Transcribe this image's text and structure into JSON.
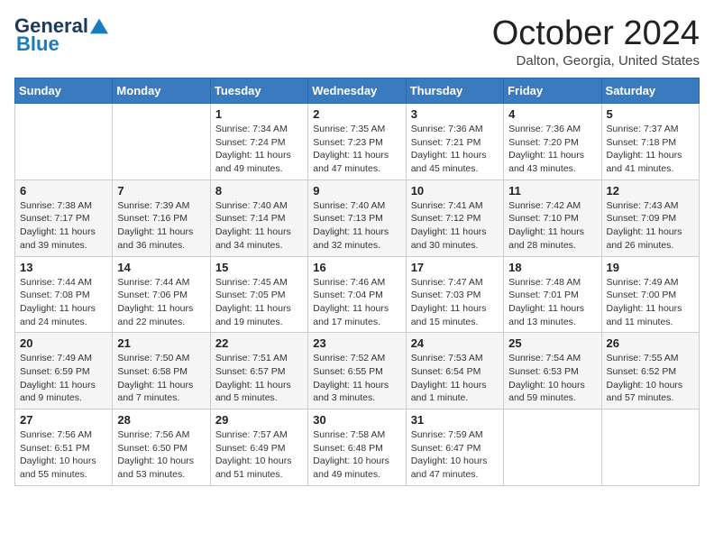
{
  "header": {
    "logo_general": "General",
    "logo_blue": "Blue",
    "month": "October 2024",
    "location": "Dalton, Georgia, United States"
  },
  "days_of_week": [
    "Sunday",
    "Monday",
    "Tuesday",
    "Wednesday",
    "Thursday",
    "Friday",
    "Saturday"
  ],
  "weeks": [
    [
      {
        "day": "",
        "sunrise": "",
        "sunset": "",
        "daylight": ""
      },
      {
        "day": "",
        "sunrise": "",
        "sunset": "",
        "daylight": ""
      },
      {
        "day": "1",
        "sunrise": "Sunrise: 7:34 AM",
        "sunset": "Sunset: 7:24 PM",
        "daylight": "Daylight: 11 hours and 49 minutes."
      },
      {
        "day": "2",
        "sunrise": "Sunrise: 7:35 AM",
        "sunset": "Sunset: 7:23 PM",
        "daylight": "Daylight: 11 hours and 47 minutes."
      },
      {
        "day": "3",
        "sunrise": "Sunrise: 7:36 AM",
        "sunset": "Sunset: 7:21 PM",
        "daylight": "Daylight: 11 hours and 45 minutes."
      },
      {
        "day": "4",
        "sunrise": "Sunrise: 7:36 AM",
        "sunset": "Sunset: 7:20 PM",
        "daylight": "Daylight: 11 hours and 43 minutes."
      },
      {
        "day": "5",
        "sunrise": "Sunrise: 7:37 AM",
        "sunset": "Sunset: 7:18 PM",
        "daylight": "Daylight: 11 hours and 41 minutes."
      }
    ],
    [
      {
        "day": "6",
        "sunrise": "Sunrise: 7:38 AM",
        "sunset": "Sunset: 7:17 PM",
        "daylight": "Daylight: 11 hours and 39 minutes."
      },
      {
        "day": "7",
        "sunrise": "Sunrise: 7:39 AM",
        "sunset": "Sunset: 7:16 PM",
        "daylight": "Daylight: 11 hours and 36 minutes."
      },
      {
        "day": "8",
        "sunrise": "Sunrise: 7:40 AM",
        "sunset": "Sunset: 7:14 PM",
        "daylight": "Daylight: 11 hours and 34 minutes."
      },
      {
        "day": "9",
        "sunrise": "Sunrise: 7:40 AM",
        "sunset": "Sunset: 7:13 PM",
        "daylight": "Daylight: 11 hours and 32 minutes."
      },
      {
        "day": "10",
        "sunrise": "Sunrise: 7:41 AM",
        "sunset": "Sunset: 7:12 PM",
        "daylight": "Daylight: 11 hours and 30 minutes."
      },
      {
        "day": "11",
        "sunrise": "Sunrise: 7:42 AM",
        "sunset": "Sunset: 7:10 PM",
        "daylight": "Daylight: 11 hours and 28 minutes."
      },
      {
        "day": "12",
        "sunrise": "Sunrise: 7:43 AM",
        "sunset": "Sunset: 7:09 PM",
        "daylight": "Daylight: 11 hours and 26 minutes."
      }
    ],
    [
      {
        "day": "13",
        "sunrise": "Sunrise: 7:44 AM",
        "sunset": "Sunset: 7:08 PM",
        "daylight": "Daylight: 11 hours and 24 minutes."
      },
      {
        "day": "14",
        "sunrise": "Sunrise: 7:44 AM",
        "sunset": "Sunset: 7:06 PM",
        "daylight": "Daylight: 11 hours and 22 minutes."
      },
      {
        "day": "15",
        "sunrise": "Sunrise: 7:45 AM",
        "sunset": "Sunset: 7:05 PM",
        "daylight": "Daylight: 11 hours and 19 minutes."
      },
      {
        "day": "16",
        "sunrise": "Sunrise: 7:46 AM",
        "sunset": "Sunset: 7:04 PM",
        "daylight": "Daylight: 11 hours and 17 minutes."
      },
      {
        "day": "17",
        "sunrise": "Sunrise: 7:47 AM",
        "sunset": "Sunset: 7:03 PM",
        "daylight": "Daylight: 11 hours and 15 minutes."
      },
      {
        "day": "18",
        "sunrise": "Sunrise: 7:48 AM",
        "sunset": "Sunset: 7:01 PM",
        "daylight": "Daylight: 11 hours and 13 minutes."
      },
      {
        "day": "19",
        "sunrise": "Sunrise: 7:49 AM",
        "sunset": "Sunset: 7:00 PM",
        "daylight": "Daylight: 11 hours and 11 minutes."
      }
    ],
    [
      {
        "day": "20",
        "sunrise": "Sunrise: 7:49 AM",
        "sunset": "Sunset: 6:59 PM",
        "daylight": "Daylight: 11 hours and 9 minutes."
      },
      {
        "day": "21",
        "sunrise": "Sunrise: 7:50 AM",
        "sunset": "Sunset: 6:58 PM",
        "daylight": "Daylight: 11 hours and 7 minutes."
      },
      {
        "day": "22",
        "sunrise": "Sunrise: 7:51 AM",
        "sunset": "Sunset: 6:57 PM",
        "daylight": "Daylight: 11 hours and 5 minutes."
      },
      {
        "day": "23",
        "sunrise": "Sunrise: 7:52 AM",
        "sunset": "Sunset: 6:55 PM",
        "daylight": "Daylight: 11 hours and 3 minutes."
      },
      {
        "day": "24",
        "sunrise": "Sunrise: 7:53 AM",
        "sunset": "Sunset: 6:54 PM",
        "daylight": "Daylight: 11 hours and 1 minute."
      },
      {
        "day": "25",
        "sunrise": "Sunrise: 7:54 AM",
        "sunset": "Sunset: 6:53 PM",
        "daylight": "Daylight: 10 hours and 59 minutes."
      },
      {
        "day": "26",
        "sunrise": "Sunrise: 7:55 AM",
        "sunset": "Sunset: 6:52 PM",
        "daylight": "Daylight: 10 hours and 57 minutes."
      }
    ],
    [
      {
        "day": "27",
        "sunrise": "Sunrise: 7:56 AM",
        "sunset": "Sunset: 6:51 PM",
        "daylight": "Daylight: 10 hours and 55 minutes."
      },
      {
        "day": "28",
        "sunrise": "Sunrise: 7:56 AM",
        "sunset": "Sunset: 6:50 PM",
        "daylight": "Daylight: 10 hours and 53 minutes."
      },
      {
        "day": "29",
        "sunrise": "Sunrise: 7:57 AM",
        "sunset": "Sunset: 6:49 PM",
        "daylight": "Daylight: 10 hours and 51 minutes."
      },
      {
        "day": "30",
        "sunrise": "Sunrise: 7:58 AM",
        "sunset": "Sunset: 6:48 PM",
        "daylight": "Daylight: 10 hours and 49 minutes."
      },
      {
        "day": "31",
        "sunrise": "Sunrise: 7:59 AM",
        "sunset": "Sunset: 6:47 PM",
        "daylight": "Daylight: 10 hours and 47 minutes."
      },
      {
        "day": "",
        "sunrise": "",
        "sunset": "",
        "daylight": ""
      },
      {
        "day": "",
        "sunrise": "",
        "sunset": "",
        "daylight": ""
      }
    ]
  ]
}
